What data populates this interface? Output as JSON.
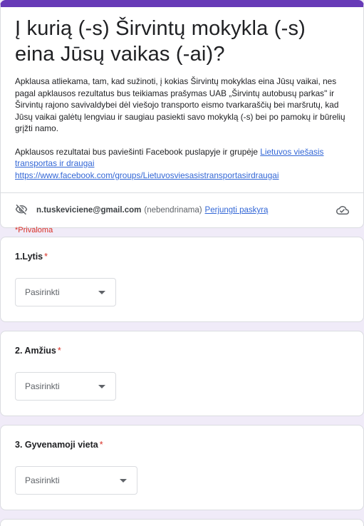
{
  "header": {
    "title": "Į kurią (-s) Širvintų mokykla (-s) eina Jūsų vaikas (-ai)?",
    "desc_para1": "Apklausa atliekama, tam, kad sužinoti, į kokias Širvintų mokyklas eina Jūsų vaikai, nes pagal apklausos rezultatus bus teikiamas prašymas UAB „Širvintų autobusų parkas\" ir Širvintų rajono savivaldybei dėl viešojo transporto eismo tvarkaraščių bei maršrutų, kad Jūsų vaikai galėtų lengviau ir saugiau pasiekti savo mokyklą (-s) bei po pamokų ir būrelių grįžti namo.",
    "desc_para2_prefix": "Apklausos rezultatai bus paviešinti Facebook puslapyje ir grupėje ",
    "desc_link1": "Lietuvos viešasis transportas ir draugai ",
    "desc_link2": "https://www.facebook.com/groups/Lietuvosviesasistransportasirdraugai"
  },
  "account": {
    "email": "n.tuskeviciene@gmail.com",
    "note": "(nebendrinama)",
    "switch_label": "Perjungti paskyrą"
  },
  "required_note": "*Privaloma",
  "questions": [
    {
      "title": "1.Lytis",
      "star": "*",
      "select_placeholder": "Pasirinkti"
    },
    {
      "title": "2. Amžius",
      "star": "*",
      "select_placeholder": "Pasirinkti"
    },
    {
      "title": "3. Gyvenamoji vieta",
      "star": "*",
      "select_placeholder": "Pasirinkti"
    }
  ],
  "icons": {
    "hidden": "eye-off-icon",
    "cloud": "cloud-done-icon"
  },
  "colors": {
    "accent": "#673ab7",
    "background": "#f0ebf8",
    "required": "#d93025",
    "link": "#3367d6"
  }
}
